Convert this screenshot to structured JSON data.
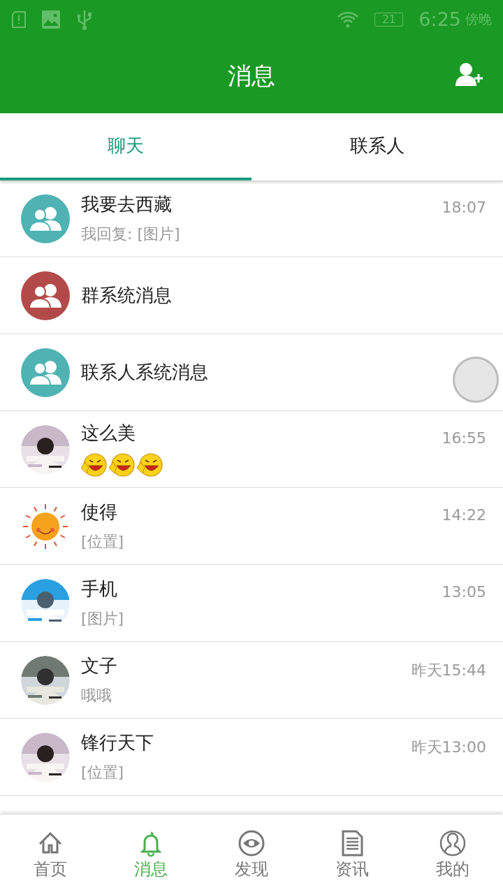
{
  "status_bar": {
    "battery": "21",
    "time": "6:25",
    "period": "傍晚"
  },
  "header": {
    "title": "消息"
  },
  "tabs": [
    {
      "label": "聊天",
      "selected": true
    },
    {
      "label": "联系人",
      "selected": false
    }
  ],
  "chats": [
    {
      "name": "我要去西藏",
      "time": "18:07",
      "preview": "我回复: [图片]",
      "avatar": {
        "kind": "group",
        "color": "#4fb3b3"
      }
    },
    {
      "name": "群系统消息",
      "avatar": {
        "kind": "group",
        "color": "#b34a4a"
      }
    },
    {
      "name": "联系人系统消息",
      "avatar": {
        "kind": "group",
        "color": "#4fb3b3"
      }
    },
    {
      "name": "这么美",
      "time": "16:55",
      "emojis": [
        {
          "kind": "emoji"
        },
        {
          "kind": "emoji"
        },
        {
          "kind": "emoji"
        }
      ]
    },
    {
      "name": "使得",
      "time": "14:22",
      "preview": "[位置]",
      "avatar": {
        "kind": "sun"
      }
    },
    {
      "name": "手机",
      "time": "13:05",
      "preview": "[图片]"
    },
    {
      "name": "文子",
      "time": "昨天15:44",
      "preview": "哦哦"
    },
    {
      "name": "锋行天下",
      "time": "昨天13:00",
      "preview": "[位置]"
    }
  ],
  "nav": [
    {
      "label": "首页",
      "selected": false
    },
    {
      "label": "消息",
      "selected": true
    },
    {
      "label": "发现",
      "selected": false
    },
    {
      "label": "资讯",
      "selected": false
    },
    {
      "label": "我的",
      "selected": false
    }
  ]
}
